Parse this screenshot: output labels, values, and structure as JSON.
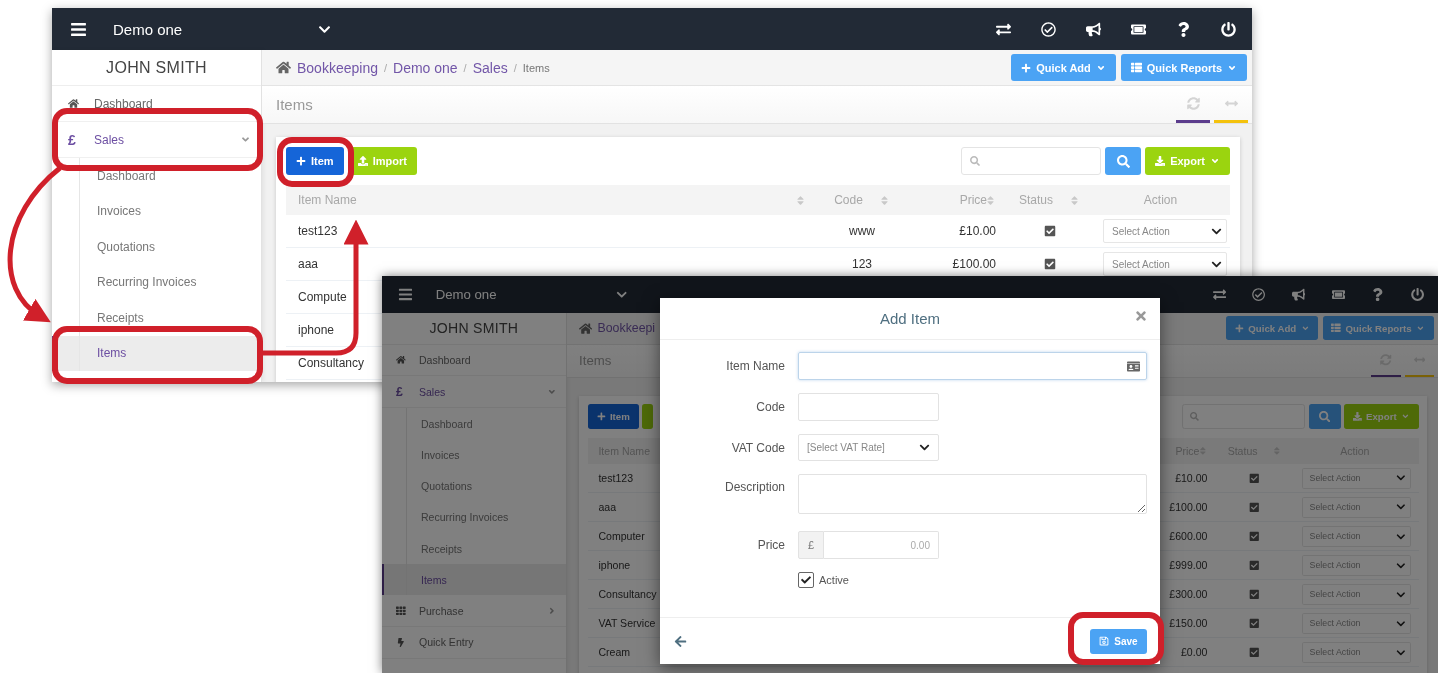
{
  "back_window": {
    "top_bar": {
      "company": "Demo one"
    },
    "sidebar": {
      "user": "JOHN SMITH",
      "items": [
        {
          "label": "Dashboard",
          "selected": false
        },
        {
          "label": "Sales",
          "glyph": "£",
          "selected": true,
          "expanded": true,
          "children": [
            {
              "label": "Dashboard",
              "selected": false
            },
            {
              "label": "Invoices",
              "selected": false
            },
            {
              "label": "Quotations",
              "selected": false
            },
            {
              "label": "Recurring Invoices",
              "selected": false
            },
            {
              "label": "Receipts",
              "selected": false
            },
            {
              "label": "Items",
              "selected": true
            }
          ]
        }
      ]
    },
    "breadcrumb": {
      "separator": "/",
      "items": [
        {
          "label": "Bookkeeping",
          "kind": "link"
        },
        {
          "label": "Demo one",
          "kind": "link"
        },
        {
          "label": "Sales",
          "kind": "link"
        },
        {
          "label": "Items",
          "kind": "current"
        }
      ]
    },
    "header_buttons": [
      "Quick Add",
      "Quick Reports"
    ],
    "page_title": "Items",
    "toolbar": {
      "buttons": [
        {
          "label": "Item",
          "kind": "primary"
        },
        {
          "label": "Import",
          "kind": "import"
        }
      ],
      "export": "Export"
    },
    "table": {
      "columns": [
        {
          "label": "Item Name",
          "kind": "text",
          "sortable": true
        },
        {
          "label": "Code",
          "kind": "code",
          "sortable": true
        },
        {
          "label": "Price",
          "kind": "money",
          "sortable": true
        },
        {
          "label": "Status",
          "kind": "check",
          "sortable": true
        },
        {
          "label": "Action",
          "kind": "select",
          "sortable": false
        }
      ],
      "rows": [
        [
          "test123",
          "www",
          "£10.00",
          true,
          "Select Action"
        ],
        [
          "aaa",
          "123",
          "£100.00",
          true,
          "Select Action"
        ],
        [
          "Compute"
        ],
        [
          "iphone"
        ],
        [
          "Consultancy"
        ]
      ]
    }
  },
  "front_window": {
    "top_bar": {
      "company": "Demo one"
    },
    "sidebar": {
      "user": "JOHN SMITH",
      "items": [
        {
          "label": "Dashboard",
          "selected": false
        },
        {
          "label": "Sales",
          "glyph": "£",
          "selected": true,
          "expanded": true,
          "children": [
            {
              "label": "Dashboard",
              "selected": false
            },
            {
              "label": "Invoices",
              "selected": false
            },
            {
              "label": "Quotations",
              "selected": false
            },
            {
              "label": "Recurring Invoices",
              "selected": false
            },
            {
              "label": "Receipts",
              "selected": false
            },
            {
              "label": "Items",
              "selected": true
            }
          ]
        },
        {
          "label": "Purchase",
          "selected": false,
          "expanded": false
        },
        {
          "label": "Quick Entry",
          "selected": false
        }
      ]
    },
    "breadcrumb": {
      "items": [
        {
          "label": "Bookkeepi",
          "kind": "link"
        }
      ]
    },
    "header_buttons": [
      "Quick Add",
      "Quick Reports"
    ],
    "page_title": "Items",
    "toolbar": {
      "buttons": [
        {
          "label": "Item",
          "kind": "primary"
        },
        {
          "kind": "import"
        }
      ],
      "export": "Export"
    },
    "table": {
      "columns": [
        {
          "label": "Item Name",
          "kind": "text",
          "sortable": false
        },
        {
          "label": "Price",
          "kind": "money",
          "sortable": true
        },
        {
          "label": "Status",
          "kind": "check",
          "sortable": true
        },
        {
          "label": "Action",
          "kind": "select",
          "sortable": false
        }
      ],
      "rows": [
        [
          "test123",
          "£10.00",
          true,
          "Select Action"
        ],
        [
          "aaa",
          "£100.00",
          true,
          "Select Action"
        ],
        [
          "Computer",
          "£600.00",
          true,
          "Select Action"
        ],
        [
          "iphone",
          "£999.00",
          true,
          "Select Action"
        ],
        [
          "Consultancy",
          "£300.00",
          true,
          "Select Action"
        ],
        [
          "VAT Service",
          "£150.00",
          true,
          "Select Action"
        ],
        [
          "Cream",
          "£0.00",
          true,
          "Select Action"
        ]
      ]
    },
    "modal": {
      "title": "Add Item",
      "fields": [
        {
          "label": "Item Name",
          "kind": "text"
        },
        {
          "label": "Code",
          "kind": "short"
        },
        {
          "label": "VAT Code",
          "kind": "select",
          "value": "[Select VAT Rate]"
        },
        {
          "label": "Description",
          "kind": "textarea"
        },
        {
          "label": "Price",
          "kind": "money",
          "prefix": "£",
          "placeholder": "0.00"
        }
      ],
      "active": {
        "label": "Active",
        "checked": true
      },
      "save": "Save"
    }
  }
}
